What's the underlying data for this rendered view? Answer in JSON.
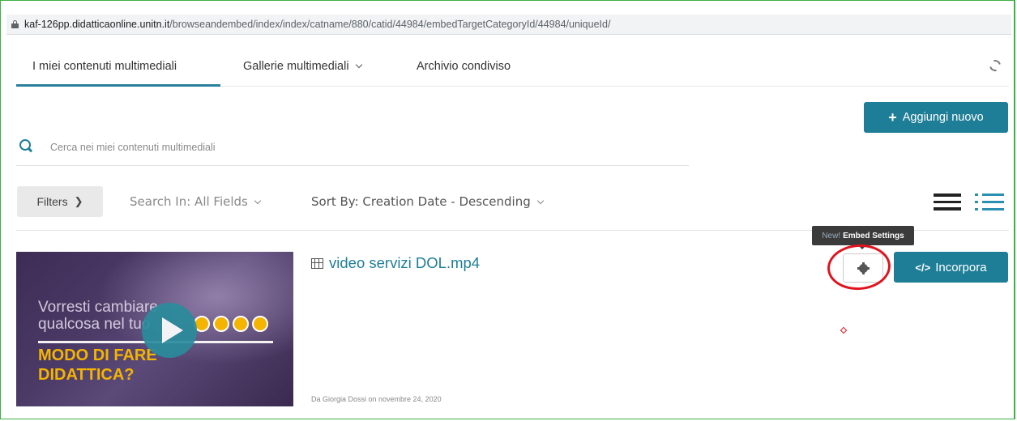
{
  "address_bar": {
    "host": "kaf-126pp.didatticaonline.unitn.it",
    "path": "/browseandembed/index/index/catname/880/catid/44984/embedTargetCategoryId/44984/uniqueId/"
  },
  "tabs": [
    {
      "label": "I miei contenuti multimediali",
      "active": true
    },
    {
      "label": "Gallerie multimediali",
      "has_dropdown": true
    },
    {
      "label": "Archivio condiviso"
    }
  ],
  "toolbar": {
    "add_new_label": "Aggiungi nuovo",
    "add_new_icon": "plus-icon"
  },
  "search": {
    "placeholder": "Cerca nei miei contenuti multimediali",
    "value": ""
  },
  "filters": {
    "filters_label": "Filters",
    "search_in_label": "Search In: All Fields",
    "sort_by_label": "Sort By: Creation Date - Descending"
  },
  "entries": [
    {
      "title": "video servizi DOL.mp4",
      "meta": "Da Giorgia Dossi on novembre 24, 2020",
      "thumbnail": {
        "line1": "Vorresti cambiare",
        "line2": "qualcosa nel tuo",
        "line3": "MODO DI FARE",
        "line4": "DIDATTICA?"
      },
      "embed_label": "Incorpora",
      "embed_code_glyph": "</>"
    }
  ],
  "tooltip": {
    "badge": "New!",
    "text": "Embed Settings"
  },
  "colors": {
    "accent": "#1e7e97",
    "highlight": "#e0141e"
  }
}
